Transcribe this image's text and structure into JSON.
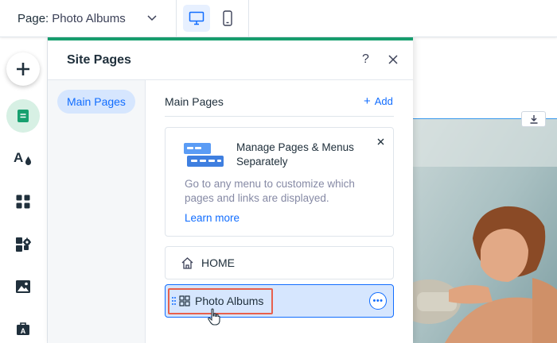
{
  "topbar": {
    "page_label": "Page:",
    "page_value": "Photo Albums",
    "dropdown_icon": "chevron-down-icon",
    "desktop_icon": "desktop-icon",
    "mobile_icon": "mobile-icon"
  },
  "left_toolbar": {
    "items": [
      {
        "name": "add",
        "icon": "plus-icon"
      },
      {
        "name": "pages",
        "icon": "page-icon"
      },
      {
        "name": "design",
        "icon": "text-drop-icon"
      },
      {
        "name": "apps",
        "icon": "apps-grid-icon"
      },
      {
        "name": "business",
        "icon": "puzzle-gear-icon"
      },
      {
        "name": "media",
        "icon": "image-icon"
      },
      {
        "name": "portfolio",
        "icon": "briefcase-icon"
      }
    ]
  },
  "panel": {
    "title": "Site Pages",
    "help_label": "?",
    "sidebar_item": "Main Pages",
    "content_title": "Main Pages",
    "add_label": "Add",
    "info_card": {
      "title": "Manage Pages & Menus Separately",
      "body": "Go to any menu to customize which pages and links are displayed.",
      "link": "Learn more"
    },
    "pages": [
      {
        "label": "HOME",
        "icon": "home-icon"
      },
      {
        "label": "Photo Albums",
        "icon": "gallery-icon",
        "selected": true
      }
    ]
  },
  "colors": {
    "accent_green": "#17a06f",
    "primary_blue": "#116dff",
    "selected_bg": "#d6e6fe",
    "highlight_red": "#e8604c"
  }
}
